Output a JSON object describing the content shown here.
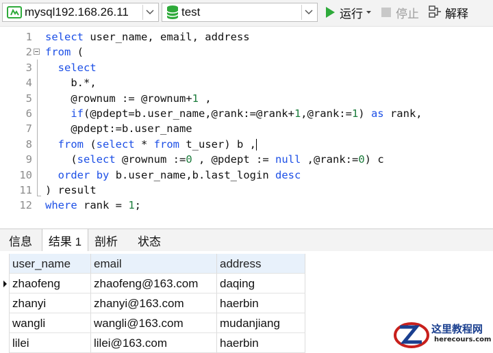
{
  "toolbar": {
    "connection": "mysql192.168.26.11",
    "database": "test",
    "run_label": "运行",
    "stop_label": "停止",
    "explain_label": "解释"
  },
  "editor": {
    "lines": [
      {
        "num": "1",
        "tokens": [
          {
            "t": "select",
            "c": "kw"
          },
          {
            "t": " user_name, email, address",
            "c": "tx"
          }
        ]
      },
      {
        "num": "2",
        "tokens": [
          {
            "t": "from",
            "c": "kw"
          },
          {
            "t": " (",
            "c": "tx"
          }
        ]
      },
      {
        "num": "3",
        "tokens": [
          {
            "t": "  ",
            "c": "tx"
          },
          {
            "t": "select",
            "c": "kw"
          }
        ]
      },
      {
        "num": "4",
        "tokens": [
          {
            "t": "    b.*,",
            "c": "tx"
          }
        ]
      },
      {
        "num": "5",
        "tokens": [
          {
            "t": "    @rownum := @rownum+",
            "c": "tx"
          },
          {
            "t": "1",
            "c": "nm"
          },
          {
            "t": " ,",
            "c": "tx"
          }
        ]
      },
      {
        "num": "6",
        "tokens": [
          {
            "t": "    ",
            "c": "tx"
          },
          {
            "t": "if",
            "c": "kw"
          },
          {
            "t": "(@pdept=b.user_name,@rank:=@rank+",
            "c": "tx"
          },
          {
            "t": "1",
            "c": "nm"
          },
          {
            "t": ",@rank:=",
            "c": "tx"
          },
          {
            "t": "1",
            "c": "nm"
          },
          {
            "t": ") ",
            "c": "tx"
          },
          {
            "t": "as",
            "c": "kw"
          },
          {
            "t": " rank,",
            "c": "tx"
          }
        ]
      },
      {
        "num": "7",
        "tokens": [
          {
            "t": "    @pdept:=b.user_name",
            "c": "tx"
          }
        ]
      },
      {
        "num": "8",
        "tokens": [
          {
            "t": "  ",
            "c": "tx"
          },
          {
            "t": "from",
            "c": "kw"
          },
          {
            "t": " (",
            "c": "tx"
          },
          {
            "t": "select",
            "c": "kw"
          },
          {
            "t": " * ",
            "c": "tx"
          },
          {
            "t": "from",
            "c": "kw"
          },
          {
            "t": " t_user) b ,",
            "c": "tx"
          }
        ]
      },
      {
        "num": "9",
        "tokens": [
          {
            "t": "    (",
            "c": "tx"
          },
          {
            "t": "select",
            "c": "kw"
          },
          {
            "t": " @rownum :=",
            "c": "tx"
          },
          {
            "t": "0",
            "c": "nm"
          },
          {
            "t": " , @pdept := ",
            "c": "tx"
          },
          {
            "t": "null",
            "c": "kw"
          },
          {
            "t": " ,@rank:=",
            "c": "tx"
          },
          {
            "t": "0",
            "c": "nm"
          },
          {
            "t": ") c",
            "c": "tx"
          }
        ]
      },
      {
        "num": "10",
        "tokens": [
          {
            "t": "  ",
            "c": "tx"
          },
          {
            "t": "order",
            "c": "kw"
          },
          {
            "t": " ",
            "c": "tx"
          },
          {
            "t": "by",
            "c": "kw"
          },
          {
            "t": " b.user_name,b.last_login ",
            "c": "tx"
          },
          {
            "t": "desc",
            "c": "kw"
          }
        ]
      },
      {
        "num": "11",
        "tokens": [
          {
            "t": ") result",
            "c": "tx"
          }
        ]
      },
      {
        "num": "12",
        "tokens": [
          {
            "t": "where",
            "c": "kw"
          },
          {
            "t": " rank = ",
            "c": "tx"
          },
          {
            "t": "1",
            "c": "nm"
          },
          {
            "t": ";",
            "c": "tx"
          }
        ]
      }
    ]
  },
  "tabs": [
    {
      "label": "信息",
      "active": false
    },
    {
      "label": "结果 1",
      "active": true
    },
    {
      "label": "剖析",
      "active": false
    },
    {
      "label": "状态",
      "active": false
    }
  ],
  "grid": {
    "columns": [
      "user_name",
      "email",
      "address"
    ],
    "rows": [
      [
        "zhaofeng",
        "zhaofeng@163.com",
        "daqing"
      ],
      [
        "zhanyi",
        "zhanyi@163.com",
        "haerbin"
      ],
      [
        "wangli",
        "wangli@163.com",
        "mudanjiang"
      ],
      [
        "lilei",
        "lilei@163.com",
        "haerbin"
      ]
    ]
  },
  "watermark": {
    "title": "这里教程网",
    "url": "herecours.com"
  },
  "colors": {
    "keyword": "#1c4fe6",
    "number": "#1c7c3c",
    "header_bg": "#e8f1fb",
    "run_icon": "#2eaa3a"
  },
  "icons": [
    "connection-icon",
    "database-icon",
    "chevron-down-icon",
    "run-icon",
    "dropdown-arrow-icon",
    "stop-icon",
    "explain-icon",
    "fold-icon",
    "row-indicator-icon",
    "site-logo-icon"
  ]
}
